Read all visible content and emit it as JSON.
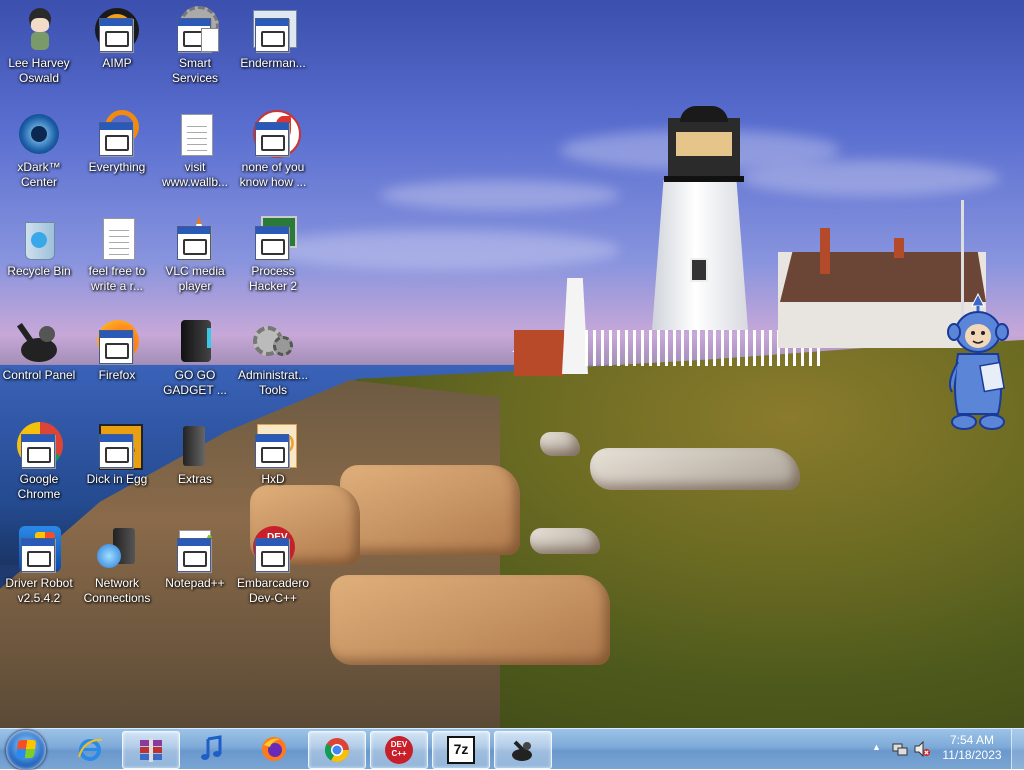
{
  "desktop": {
    "icons": [
      {
        "label": "Lee Harvey\nOswald",
        "icon": "anime-character-icon"
      },
      {
        "label": "AIMP",
        "icon": "aimp-icon"
      },
      {
        "label": "Smart\nServices",
        "icon": "smart-services-icon"
      },
      {
        "label": "Enderman...",
        "icon": "enderman-icon"
      },
      {
        "label": "xDark™\nCenter",
        "icon": "xdark-center-icon"
      },
      {
        "label": "Everything",
        "icon": "everything-icon"
      },
      {
        "label": "visit\nwww.wallb...",
        "icon": "text-document-icon"
      },
      {
        "label": "none of you\nknow how ...",
        "icon": "app-shortcut-icon"
      },
      {
        "label": "Recycle Bin",
        "icon": "recycle-bin-icon"
      },
      {
        "label": "feel free to\nwrite a r...",
        "icon": "text-document-icon"
      },
      {
        "label": "VLC media\nplayer",
        "icon": "vlc-icon"
      },
      {
        "label": "Process\nHacker 2",
        "icon": "process-hacker-icon"
      },
      {
        "label": "Control Panel",
        "icon": "control-panel-icon"
      },
      {
        "label": "Firefox",
        "icon": "firefox-icon"
      },
      {
        "label": "GO GO\nGADGET ...",
        "icon": "gadget-icon"
      },
      {
        "label": "Administrat...\nTools",
        "icon": "admin-tools-icon"
      },
      {
        "label": "Google\nChrome",
        "icon": "chrome-icon"
      },
      {
        "label": "Dick in Egg",
        "icon": "egg-app-icon"
      },
      {
        "label": "Extras",
        "icon": "extras-icon"
      },
      {
        "label": "HxD",
        "icon": "hxd-icon"
      },
      {
        "label": "Driver Robot\nv2.5.4.2",
        "icon": "driver-robot-icon"
      },
      {
        "label": "Network\nConnections",
        "icon": "network-connections-icon"
      },
      {
        "label": "Notepad++",
        "icon": "notepad-plus-plus-icon"
      },
      {
        "label": "Embarcadero\nDev-C++",
        "icon": "dev-cpp-icon"
      }
    ]
  },
  "taskbar": {
    "start_icon": "windows-start-orb",
    "pinned": [
      {
        "name": "internet-explorer",
        "icon": "internet-explorer-icon"
      },
      {
        "name": "winrar",
        "icon": "winrar-icon"
      },
      {
        "name": "music-player",
        "icon": "music-note-icon"
      },
      {
        "name": "firefox",
        "icon": "firefox-icon"
      },
      {
        "name": "chrome",
        "icon": "chrome-icon"
      },
      {
        "name": "dev-cpp",
        "icon": "dev-cpp-icon",
        "text": "DEV\nC++"
      },
      {
        "name": "7zip",
        "icon": "7zip-icon",
        "text": "7z"
      },
      {
        "name": "control-panel",
        "icon": "control-panel-icon"
      }
    ],
    "tray": {
      "show_hidden_icon": "▲",
      "network_icon": "network-tray-icon",
      "volume_icon": "volume-muted-icon",
      "time": "7:54 AM",
      "date": "11/18/2023"
    }
  },
  "colors": {
    "taskbar_top": "#9cc3e8",
    "taskbar_bottom": "#6a98cc",
    "sky": "#5a6fd0"
  }
}
